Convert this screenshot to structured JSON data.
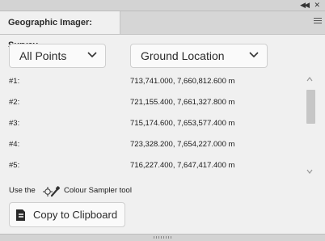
{
  "window": {
    "collapse_icon": "double-chevron-left",
    "close_icon": "close-x"
  },
  "tab": {
    "title": "Geographic Imager: Survey",
    "menu_icon": "hamburger-menu"
  },
  "controls": {
    "points_select": "All Points",
    "location_select": "Ground Location"
  },
  "points": [
    {
      "label": "#1:",
      "value": "713,741.000, 7,660,812.600 m"
    },
    {
      "label": "#2:",
      "value": "721,155.400, 7,661,327.800 m"
    },
    {
      "label": "#3:",
      "value": "715,174.600, 7,653,577.400 m"
    },
    {
      "label": "#4:",
      "value": "723,328.200, 7,654,227.000 m"
    },
    {
      "label": "#5:",
      "value": "716,227.400, 7,647,417.400 m"
    }
  ],
  "hint": {
    "before": "Use the",
    "after": "Colour Sampler tool",
    "icon": "colour-sampler-tool"
  },
  "copy": {
    "label": "Copy to Clipboard",
    "icon": "clipboard-copy"
  }
}
